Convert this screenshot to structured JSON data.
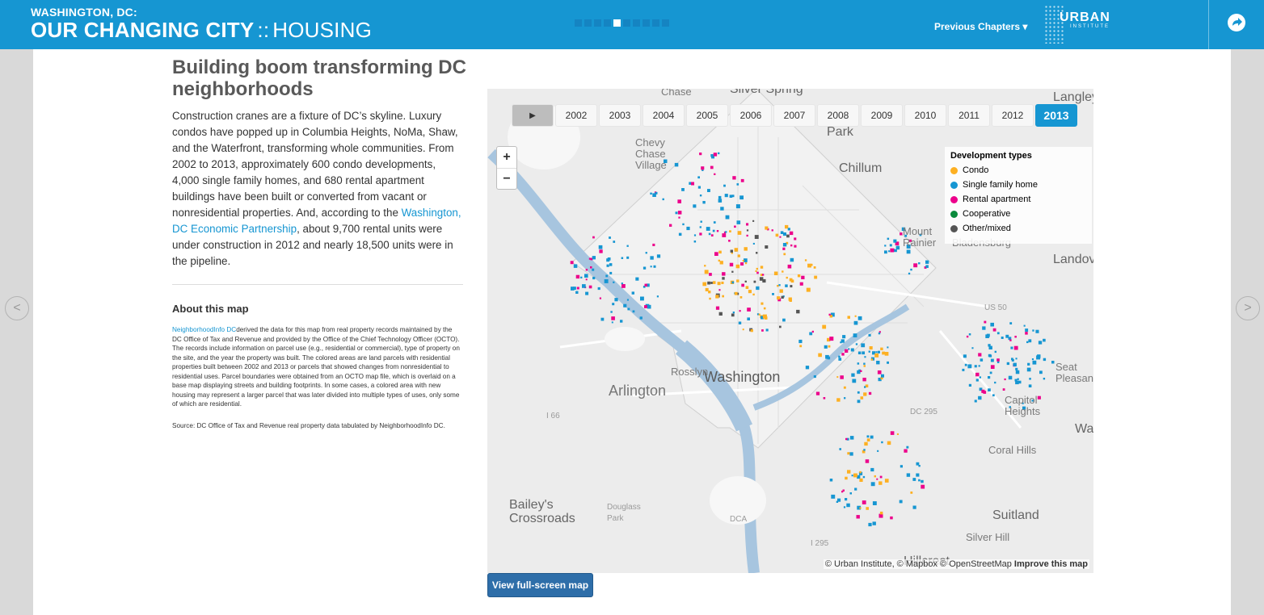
{
  "header": {
    "kicker": "WASHINGTON, DC:",
    "title_strong": "OUR CHANGING CITY",
    "title_sep": "::",
    "title_sub": "HOUSING",
    "chapter_count": 10,
    "active_chapter": 5,
    "previous_chapters": "Previous Chapters",
    "logo_text": "URBAN",
    "logo_sub": "INSTITUTE",
    "share_icon": "share-arrow-icon"
  },
  "article": {
    "title": "Building boom transforming DC neighborhoods",
    "body_before_link": "Construction cranes are a fixture of DC’s skyline. Luxury condos have popped up in Columbia Heights, NoMa, Shaw, and the Waterfront, transforming whole communities. From 2002 to 2013, approximately 600 condo developments, 4,000 single family homes, and 680 rental apartment buildings have been built or converted from vacant or nonresidential properties. And, according to the ",
    "link_text": "Washington, DC Economic Partnership",
    "body_after_link": ", about 9,700 rental units were under construction in 2012 and nearly 18,500 units were in the pipeline."
  },
  "about": {
    "title": "About this map",
    "link_text": "NeighborhoodInfo DC",
    "body": "derived the data for this map from real property records maintained by the DC Office of Tax and Revenue and provided by the Office of the Chief Technology Officer (OCTO). The records include information on parcel use (e.g., residential or commercial), type of property on the site, and the year the property was built. The colored areas are land parcels with residential properties built between 2002 and 2013 or parcels that showed changes from nonresidential to residential uses. Parcel boundaries were obtained from an OCTO map file, which is overlaid on a base map displaying streets and building footprints. In some cases, a colored area with new housing may represent a larger parcel that was later divided into multiple types of uses, only some of which are residential.",
    "source": "Source: DC Office of Tax and Revenue real property data tabulated by NeighborhoodInfo DC."
  },
  "map": {
    "play_label": "▶",
    "years": [
      "2002",
      "2003",
      "2004",
      "2005",
      "2006",
      "2007",
      "2008",
      "2009",
      "2010",
      "2011",
      "2012",
      "2013"
    ],
    "active_year": "2013",
    "zoom_in": "+",
    "zoom_out": "−",
    "legend": {
      "title": "Development types",
      "items": [
        {
          "label": "Condo",
          "color": "#fdb022"
        },
        {
          "label": "Single family home",
          "color": "#1696d2"
        },
        {
          "label": "Rental apartment",
          "color": "#ec008b"
        },
        {
          "label": "Cooperative",
          "color": "#0a8a3c"
        },
        {
          "label": "Other/mixed",
          "color": "#555555"
        }
      ]
    },
    "labels": {
      "washington": "Washington",
      "arlington": "Arlington",
      "rosslyn": "Rosslyn",
      "chillum": "Chillum",
      "mount_rainier": "Mount Rainier",
      "bladensburg": "Bladensburg",
      "landover": "Landov",
      "seat_pleasant": "Seat Pleasant",
      "capitol_heights": "Capitol Heights",
      "coral_hills": "Coral Hills",
      "suitland": "Suitland",
      "silver_hill": "Silver Hill",
      "baileys_crossroads": "Bailey's Crossroads",
      "douglass_park": "Douglass Park",
      "dca": "DCA",
      "chevy_chase_village": "Chevy Chase Village",
      "hillcrest": "Hillcrest",
      "park": "Park",
      "chase": "Chase",
      "silver_spring": "Silver Spring",
      "langley": "Langley",
      "us50": "US 50",
      "dc295": "DC 295",
      "i66": "I 66",
      "i295": "I 295",
      "wa": "Wa"
    },
    "attribution_plain": "© Urban Institute, © Mapbox © OpenStreetMap ",
    "attribution_bold": "Improve this map",
    "fullscreen_button": "View full-screen map"
  }
}
